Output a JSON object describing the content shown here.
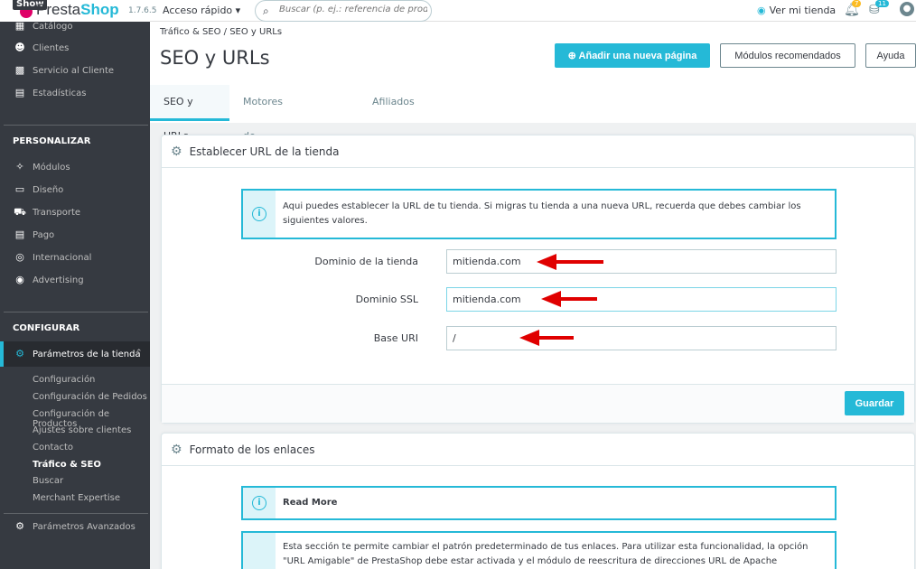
{
  "topbar": {
    "show_label": "Show",
    "logo_prefix": "Presta",
    "logo_suffix": "Shop",
    "version": "1.7.6.5",
    "quick_access": "Acceso rápido ▾",
    "search_placeholder": "Buscar (p. ej.: referencia de producto, n",
    "view_shop": "Ver mi tienda",
    "notif_badge": "7",
    "cart_badge": "11"
  },
  "sidebar": {
    "items_top": [
      {
        "icon": "catalog-icon",
        "label": "Catálogo"
      },
      {
        "icon": "customers-icon",
        "label": "Clientes"
      },
      {
        "icon": "service-icon",
        "label": "Servicio al Cliente"
      },
      {
        "icon": "stats-icon",
        "label": "Estadísticas"
      }
    ],
    "section_customize": "PERSONALIZAR",
    "items_customize": [
      {
        "icon": "modules-icon",
        "label": "Módulos"
      },
      {
        "icon": "design-icon",
        "label": "Diseño"
      },
      {
        "icon": "shipping-icon",
        "label": "Transporte"
      },
      {
        "icon": "payment-icon",
        "label": "Pago"
      },
      {
        "icon": "international-icon",
        "label": "Internacional"
      },
      {
        "icon": "advertising-icon",
        "label": "Advertising"
      }
    ],
    "section_configure": "CONFIGURAR",
    "active_item": "Parámetros de la tienda",
    "sub_items": [
      "Configuración",
      "Configuración de Pedidos",
      "Configuración de Productos",
      "Ajustes sobre clientes",
      "Contacto",
      "Tráfico & SEO",
      "Buscar",
      "Merchant Expertise"
    ],
    "current_sub": "Tráfico & SEO",
    "advanced": "Parámetros Avanzados"
  },
  "header": {
    "breadcrumb": "Tráfico & SEO  /  SEO y URLs",
    "title": "SEO y URLs",
    "add_page": "Añadir una nueva página",
    "recommended": "Módulos recomendados",
    "help": "Ayuda",
    "tabs": [
      "SEO y URLs",
      "Motores de búsqueda",
      "Afiliados"
    ]
  },
  "shop_url_panel": {
    "title": "Establecer URL de la tienda",
    "info": "Aqui puedes establecer la URL de tu tienda. Si migras tu tienda a una nueva URL, recuerda que debes cambiar los siguientes valores.",
    "fields": [
      {
        "label": "Dominio de la tienda",
        "value": "mitienda.com"
      },
      {
        "label": "Dominio SSL",
        "value": "mitienda.com"
      },
      {
        "label": "Base URI",
        "value": "/"
      }
    ],
    "save": "Guardar"
  },
  "links_panel": {
    "title": "Formato de los enlaces",
    "read_more": "Read More",
    "info": "Esta sección te permite cambiar el patrón predeterminado de tus enlaces. Para utilizar esta funcionalidad, la opción \"URL Amigable\" de PrestaShop debe estar activada y el módulo de reescritura de direcciones URL de Apache"
  },
  "colors": {
    "accent": "#25b9d7",
    "sidebar": "#363a41",
    "arrow": "#e00000"
  }
}
